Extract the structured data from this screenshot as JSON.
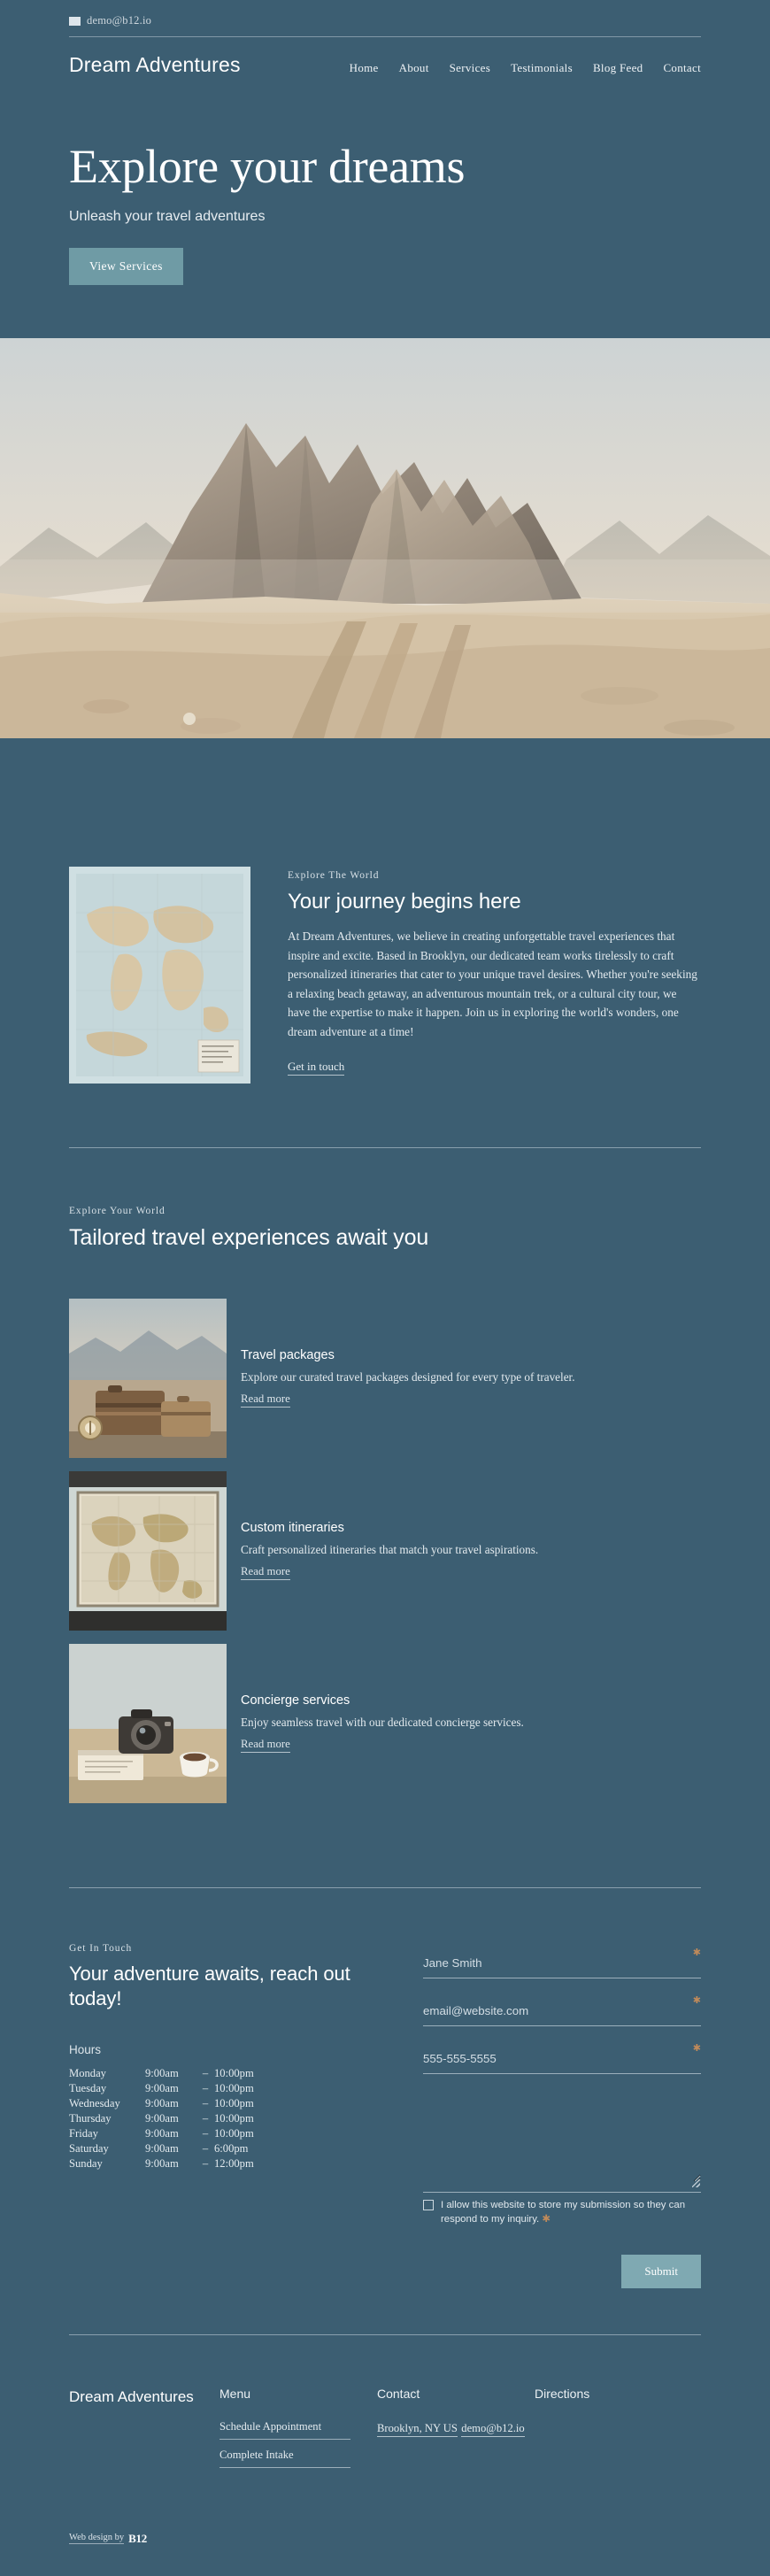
{
  "theme": {
    "bg": "#3c5e72",
    "button": "#6f9ba5",
    "submit_button": "#7fa9b2",
    "required_star": "#c08a5a",
    "text": "#ffffff"
  },
  "topbar": {
    "email": "demo@b12.io",
    "mail_icon": "mail-icon"
  },
  "nav": {
    "brand": "Dream Adventures",
    "links": [
      {
        "label": "Home"
      },
      {
        "label": "About"
      },
      {
        "label": "Services"
      },
      {
        "label": "Testimonials"
      },
      {
        "label": "Blog Feed"
      },
      {
        "label": "Contact"
      }
    ]
  },
  "hero": {
    "title": "Explore your dreams",
    "subtitle": "Unleash your travel adventures",
    "cta": "View Services",
    "image_alt": "desert-mountain-landscape"
  },
  "about": {
    "eyebrow": "Explore The World",
    "title": "Your journey begins here",
    "body": "At Dream Adventures, we believe in creating unforgettable travel experiences that inspire and excite. Based in Brooklyn, our dedicated team works tirelessly to craft personalized itineraries that cater to your unique travel desires. Whether you're seeking a relaxing beach getaway, an adventurous mountain trek, or a cultural city tour, we have the expertise to make it happen. Join us in exploring the world's wonders, one dream adventure at a time!",
    "link": "Get in touch",
    "image_alt": "vintage-world-map"
  },
  "services": {
    "eyebrow": "Explore Your World",
    "title": "Tailored travel experiences await you",
    "items": [
      {
        "title": "Travel packages",
        "desc": "Explore our curated travel packages designed for every type of traveler.",
        "link": "Read more",
        "image_alt": "vintage-suitcases"
      },
      {
        "title": "Custom itineraries",
        "desc": "Craft personalized itineraries that match your travel aspirations.",
        "link": "Read more",
        "image_alt": "framed-world-map"
      },
      {
        "title": "Concierge services",
        "desc": "Enjoy seamless travel with our dedicated concierge services.",
        "link": "Read more",
        "image_alt": "desk-with-camera-and-notebook"
      }
    ]
  },
  "contact": {
    "eyebrow": "Get In Touch",
    "title": "Your adventure awaits, reach out today!",
    "hours_label": "Hours",
    "hours": [
      {
        "day": "Monday",
        "open": "9:00am",
        "dash": "–",
        "close": "10:00pm"
      },
      {
        "day": "Tuesday",
        "open": "9:00am",
        "dash": "–",
        "close": "10:00pm"
      },
      {
        "day": "Wednesday",
        "open": "9:00am",
        "dash": "–",
        "close": "10:00pm"
      },
      {
        "day": "Thursday",
        "open": "9:00am",
        "dash": "–",
        "close": "10:00pm"
      },
      {
        "day": "Friday",
        "open": "9:00am",
        "dash": "–",
        "close": "10:00pm"
      },
      {
        "day": "Saturday",
        "open": "9:00am",
        "dash": "–",
        "close": "6:00pm"
      },
      {
        "day": "Sunday",
        "open": "9:00am",
        "dash": "–",
        "close": "12:00pm"
      }
    ],
    "form": {
      "name_placeholder": "Jane Smith",
      "email_placeholder": "email@website.com",
      "phone_placeholder": "555-555-5555",
      "message_placeholder": "",
      "required_mark": "✱",
      "consent_text": "I allow this website to store my submission so they can respond to my inquiry.",
      "consent_star": "✱",
      "submit_label": "Submit"
    }
  },
  "footer": {
    "brand": "Dream Adventures",
    "columns": [
      {
        "heading": "Menu",
        "links": [
          {
            "label": "Schedule Appointment"
          },
          {
            "label": "Complete Intake"
          }
        ]
      },
      {
        "heading": "Contact",
        "links": [
          {
            "label": "Brooklyn, NY US"
          },
          {
            "label": "demo@b12.io"
          }
        ]
      },
      {
        "heading": "Directions",
        "links": []
      }
    ],
    "credit_text": "Web design by",
    "credit_brand": "B12"
  }
}
